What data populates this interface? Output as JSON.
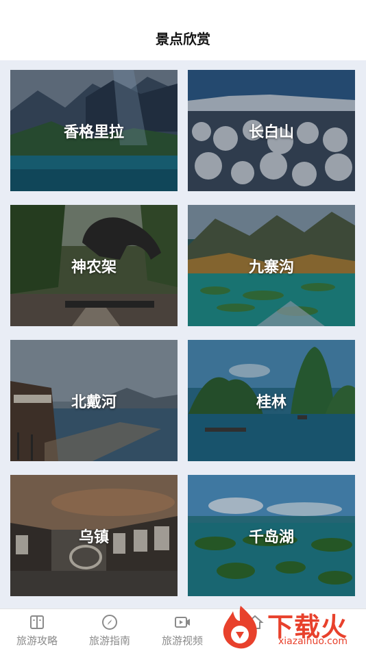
{
  "header": {
    "title": "景点欣赏"
  },
  "spots": [
    {
      "name": "香格里拉"
    },
    {
      "name": "长白山"
    },
    {
      "name": "神农架"
    },
    {
      "name": "九寨沟"
    },
    {
      "name": "北戴河"
    },
    {
      "name": "桂林"
    },
    {
      "name": "乌镇"
    },
    {
      "name": "千岛湖"
    }
  ],
  "tabbar": {
    "items": [
      {
        "label": "旅游攻略",
        "icon": "book-icon"
      },
      {
        "label": "旅游指南",
        "icon": "compass-icon"
      },
      {
        "label": "旅游视频",
        "icon": "video-icon"
      },
      {
        "label": "",
        "icon": "home-icon"
      }
    ]
  },
  "watermark": {
    "brand": "下载火",
    "url": "xiazaihuo.com"
  },
  "colors": {
    "accent": "#e8412c",
    "tab_text": "#8a8a8a",
    "background": "#e9edf5"
  }
}
